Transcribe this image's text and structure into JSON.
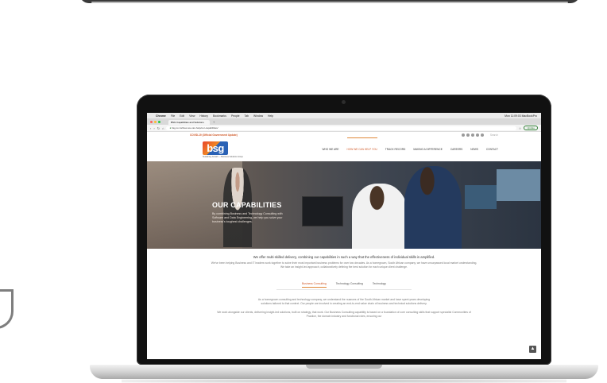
{
  "browser": {
    "menu": [
      "Chrome",
      "File",
      "Edit",
      "View",
      "History",
      "Bookmarks",
      "People",
      "Tab",
      "Window",
      "Help"
    ],
    "status": "Mon 11:09:03  MacBookPro",
    "tab_title": "BSG Capabilities and Solutions",
    "new_tab": "+",
    "url": "bsg.co.za/how-we-can-help/our-capabilities/",
    "update_label": "Update",
    "traffic_colors": [
      "#ff5f57",
      "#febc2e",
      "#28c840"
    ]
  },
  "site": {
    "covid_link": "COVID-19 (Official Government Update)",
    "search_placeholder": "Search",
    "logo_text": "bsg",
    "tagline": "Sustaining Growth — Business Solutions Group",
    "nav": [
      "WHO WE ARE",
      "HOW WE CAN HELP YOU",
      "TRACK RECORD",
      "MAKING A DIFFERENCE",
      "CAREERS",
      "NEWS",
      "CONTACT"
    ],
    "hero": {
      "title": "OUR CAPABILITIES",
      "subtitle": "By combining Business and Technology Consulting with Software and Data Engineering, we help you solve your business's toughest challenges."
    },
    "intro_lead": "We offer multi-skilled delivery, combining our capabilities in such a way that the effectiveness of individual skills is amplified.",
    "intro_body": "We've been helping Business and IT leaders work together to solve their most important business problems for over two decades. As a homegrown, South African company, we have unsurpassed local market understanding. We take an insight-led approach, collaboratively defining the best solution for each unique client challenge.",
    "tabs": [
      "Business Consulting",
      "Technology Consulting",
      "Technology"
    ],
    "tab_para1": "As a homegrown consulting and technology company, we understand the nuances of the South African market and have spent years developing solutions tailored to that context. Our people are involved in creating an end-to-end value chain of business and technical solutions delivery.",
    "tab_para2": "We work alongside our clients, delivering insight-led solutions, built on strategy, that work. Our Business Consulting capability is based on a foundation of core consulting skills that support specialist Communities of Practice, the domain industry and functional roles, ensuring our",
    "scroll_top": "▲",
    "accent_color": "#e0893a"
  }
}
